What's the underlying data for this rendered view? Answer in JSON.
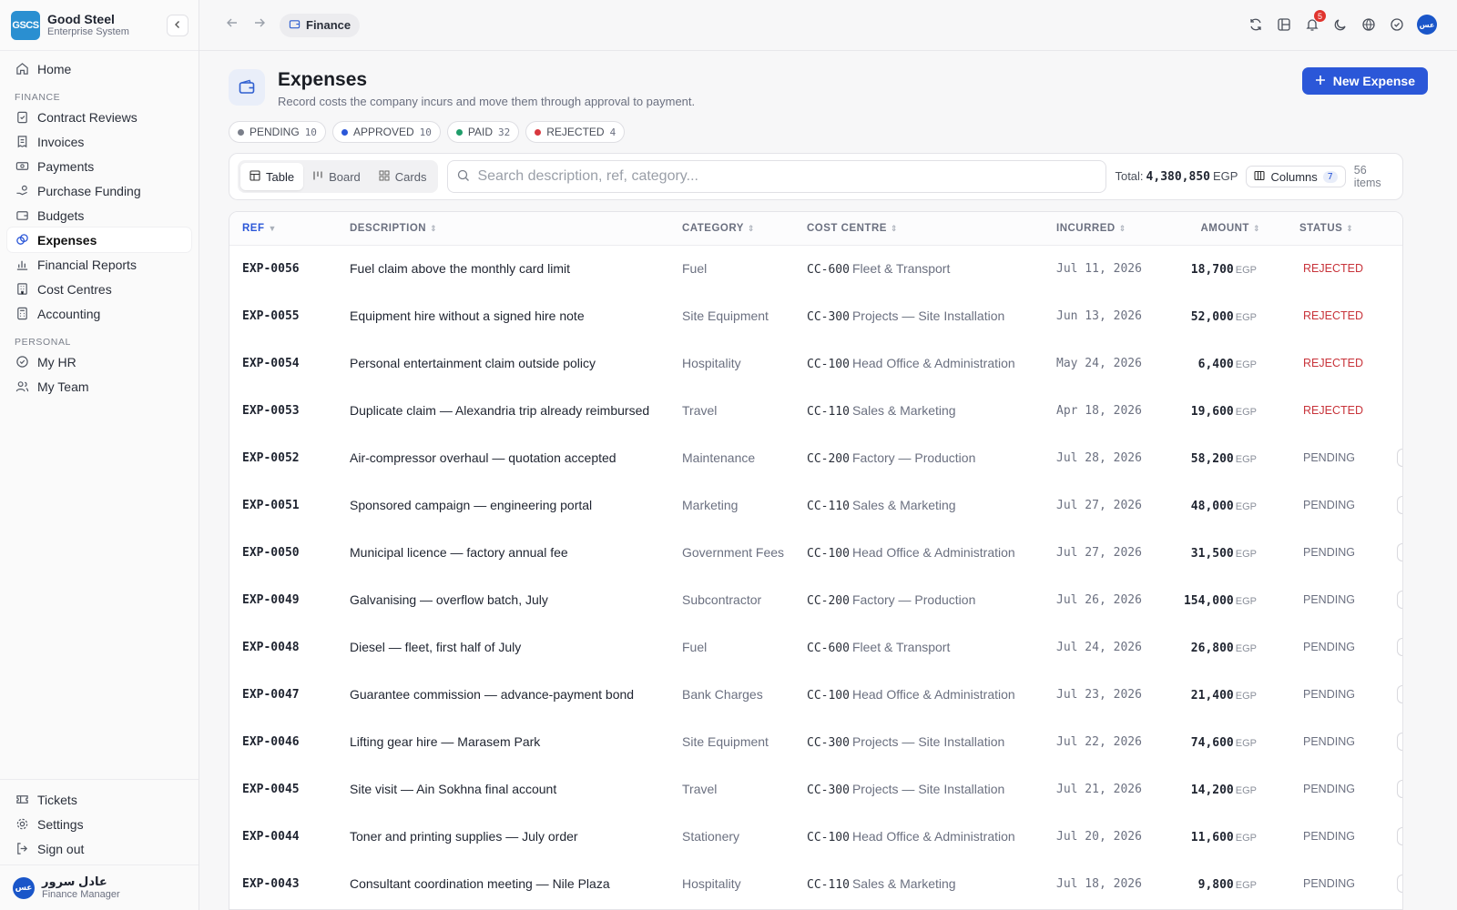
{
  "brand": {
    "logo": "GSCS",
    "name": "Good Steel",
    "subtitle": "Enterprise System"
  },
  "sidebar": {
    "home": "Home",
    "finance_section": "FINANCE",
    "finance_items": [
      {
        "label": "Contract Reviews",
        "icon": "clipboard-check-icon"
      },
      {
        "label": "Invoices",
        "icon": "receipt-icon"
      },
      {
        "label": "Payments",
        "icon": "banknote-icon"
      },
      {
        "label": "Purchase Funding",
        "icon": "hand-coins-icon"
      },
      {
        "label": "Budgets",
        "icon": "wallet-icon"
      },
      {
        "label": "Expenses",
        "icon": "coins-icon",
        "active": true
      },
      {
        "label": "Financial Reports",
        "icon": "bar-chart-icon"
      },
      {
        "label": "Cost Centres",
        "icon": "building-icon"
      },
      {
        "label": "Accounting",
        "icon": "calculator-icon"
      }
    ],
    "personal_section": "PERSONAL",
    "personal_items": [
      {
        "label": "My HR",
        "icon": "badge-check-icon"
      },
      {
        "label": "My Team",
        "icon": "users-icon"
      }
    ],
    "bottom_items": [
      {
        "label": "Tickets",
        "icon": "ticket-icon"
      },
      {
        "label": "Settings",
        "icon": "gear-icon"
      },
      {
        "label": "Sign out",
        "icon": "logout-icon"
      }
    ],
    "user": {
      "initials": "عس",
      "name": "عادل سرور",
      "role": "Finance Manager"
    }
  },
  "topbar": {
    "breadcrumb": "Finance",
    "notifications": "5",
    "avatar": "عس"
  },
  "header": {
    "title": "Expenses",
    "subtitle": "Record costs the company incurs and move them through approval to payment.",
    "new_button": "New Expense"
  },
  "status_pills": [
    {
      "label": "PENDING",
      "count": "10",
      "color": "#7a7f8a"
    },
    {
      "label": "APPROVED",
      "count": "10",
      "color": "#2b57d8"
    },
    {
      "label": "PAID",
      "count": "32",
      "color": "#1f9d6a"
    },
    {
      "label": "REJECTED",
      "count": "4",
      "color": "#d8373e"
    }
  ],
  "toolbar": {
    "views": [
      "Table",
      "Board",
      "Cards"
    ],
    "active_view": "Table",
    "search_placeholder": "Search description, ref, category...",
    "total_label": "Total:",
    "total_value": "4,380,850",
    "total_currency": "EGP",
    "columns_label": "Columns",
    "columns_count": "7",
    "items_count": "56 items"
  },
  "table": {
    "columns": [
      "REF",
      "DESCRIPTION",
      "CATEGORY",
      "COST CENTRE",
      "INCURRED",
      "AMOUNT",
      "STATUS"
    ],
    "rows": [
      {
        "ref": "EXP-0056",
        "desc": "Fuel claim above the monthly card limit",
        "cat": "Fuel",
        "cc": "CC-600",
        "ccname": "Fleet & Transport",
        "date": "Jul 11, 2026",
        "amount": "18,700",
        "cur": "EGP",
        "status": "REJECTED"
      },
      {
        "ref": "EXP-0055",
        "desc": "Equipment hire without a signed hire note",
        "cat": "Site Equipment",
        "cc": "CC-300",
        "ccname": "Projects — Site Installation",
        "date": "Jun 13, 2026",
        "amount": "52,000",
        "cur": "EGP",
        "status": "REJECTED"
      },
      {
        "ref": "EXP-0054",
        "desc": "Personal entertainment claim outside policy",
        "cat": "Hospitality",
        "cc": "CC-100",
        "ccname": "Head Office & Administration",
        "date": "May 24, 2026",
        "amount": "6,400",
        "cur": "EGP",
        "status": "REJECTED"
      },
      {
        "ref": "EXP-0053",
        "desc": "Duplicate claim — Alexandria trip already reimbursed",
        "cat": "Travel",
        "cc": "CC-110",
        "ccname": "Sales & Marketing",
        "date": "Apr 18, 2026",
        "amount": "19,600",
        "cur": "EGP",
        "status": "REJECTED"
      },
      {
        "ref": "EXP-0052",
        "desc": "Air-compressor overhaul — quotation accepted",
        "cat": "Maintenance",
        "cc": "CC-200",
        "ccname": "Factory — Production",
        "date": "Jul 28, 2026",
        "amount": "58,200",
        "cur": "EGP",
        "status": "PENDING"
      },
      {
        "ref": "EXP-0051",
        "desc": "Sponsored campaign — engineering portal",
        "cat": "Marketing",
        "cc": "CC-110",
        "ccname": "Sales & Marketing",
        "date": "Jul 27, 2026",
        "amount": "48,000",
        "cur": "EGP",
        "status": "PENDING"
      },
      {
        "ref": "EXP-0050",
        "desc": "Municipal licence — factory annual fee",
        "cat": "Government Fees",
        "cc": "CC-100",
        "ccname": "Head Office & Administration",
        "date": "Jul 27, 2026",
        "amount": "31,500",
        "cur": "EGP",
        "status": "PENDING"
      },
      {
        "ref": "EXP-0049",
        "desc": "Galvanising — overflow batch, July",
        "cat": "Subcontractor",
        "cc": "CC-200",
        "ccname": "Factory — Production",
        "date": "Jul 26, 2026",
        "amount": "154,000",
        "cur": "EGP",
        "status": "PENDING"
      },
      {
        "ref": "EXP-0048",
        "desc": "Diesel — fleet, first half of July",
        "cat": "Fuel",
        "cc": "CC-600",
        "ccname": "Fleet & Transport",
        "date": "Jul 24, 2026",
        "amount": "26,800",
        "cur": "EGP",
        "status": "PENDING"
      },
      {
        "ref": "EXP-0047",
        "desc": "Guarantee commission — advance-payment bond",
        "cat": "Bank Charges",
        "cc": "CC-100",
        "ccname": "Head Office & Administration",
        "date": "Jul 23, 2026",
        "amount": "21,400",
        "cur": "EGP",
        "status": "PENDING"
      },
      {
        "ref": "EXP-0046",
        "desc": "Lifting gear hire — Marasem Park",
        "cat": "Site Equipment",
        "cc": "CC-300",
        "ccname": "Projects — Site Installation",
        "date": "Jul 22, 2026",
        "amount": "74,600",
        "cur": "EGP",
        "status": "PENDING"
      },
      {
        "ref": "EXP-0045",
        "desc": "Site visit — Ain Sokhna final account",
        "cat": "Travel",
        "cc": "CC-300",
        "ccname": "Projects — Site Installation",
        "date": "Jul 21, 2026",
        "amount": "14,200",
        "cur": "EGP",
        "status": "PENDING"
      },
      {
        "ref": "EXP-0044",
        "desc": "Toner and printing supplies — July order",
        "cat": "Stationery",
        "cc": "CC-100",
        "ccname": "Head Office & Administration",
        "date": "Jul 20, 2026",
        "amount": "11,600",
        "cur": "EGP",
        "status": "PENDING"
      },
      {
        "ref": "EXP-0043",
        "desc": "Consultant coordination meeting — Nile Plaza",
        "cat": "Hospitality",
        "cc": "CC-110",
        "ccname": "Sales & Marketing",
        "date": "Jul 18, 2026",
        "amount": "9,800",
        "cur": "EGP",
        "status": "PENDING"
      }
    ]
  },
  "colors": {
    "accent": "#2b57d8",
    "rejected": "#c8333a",
    "brand": "#2a8fd1"
  }
}
